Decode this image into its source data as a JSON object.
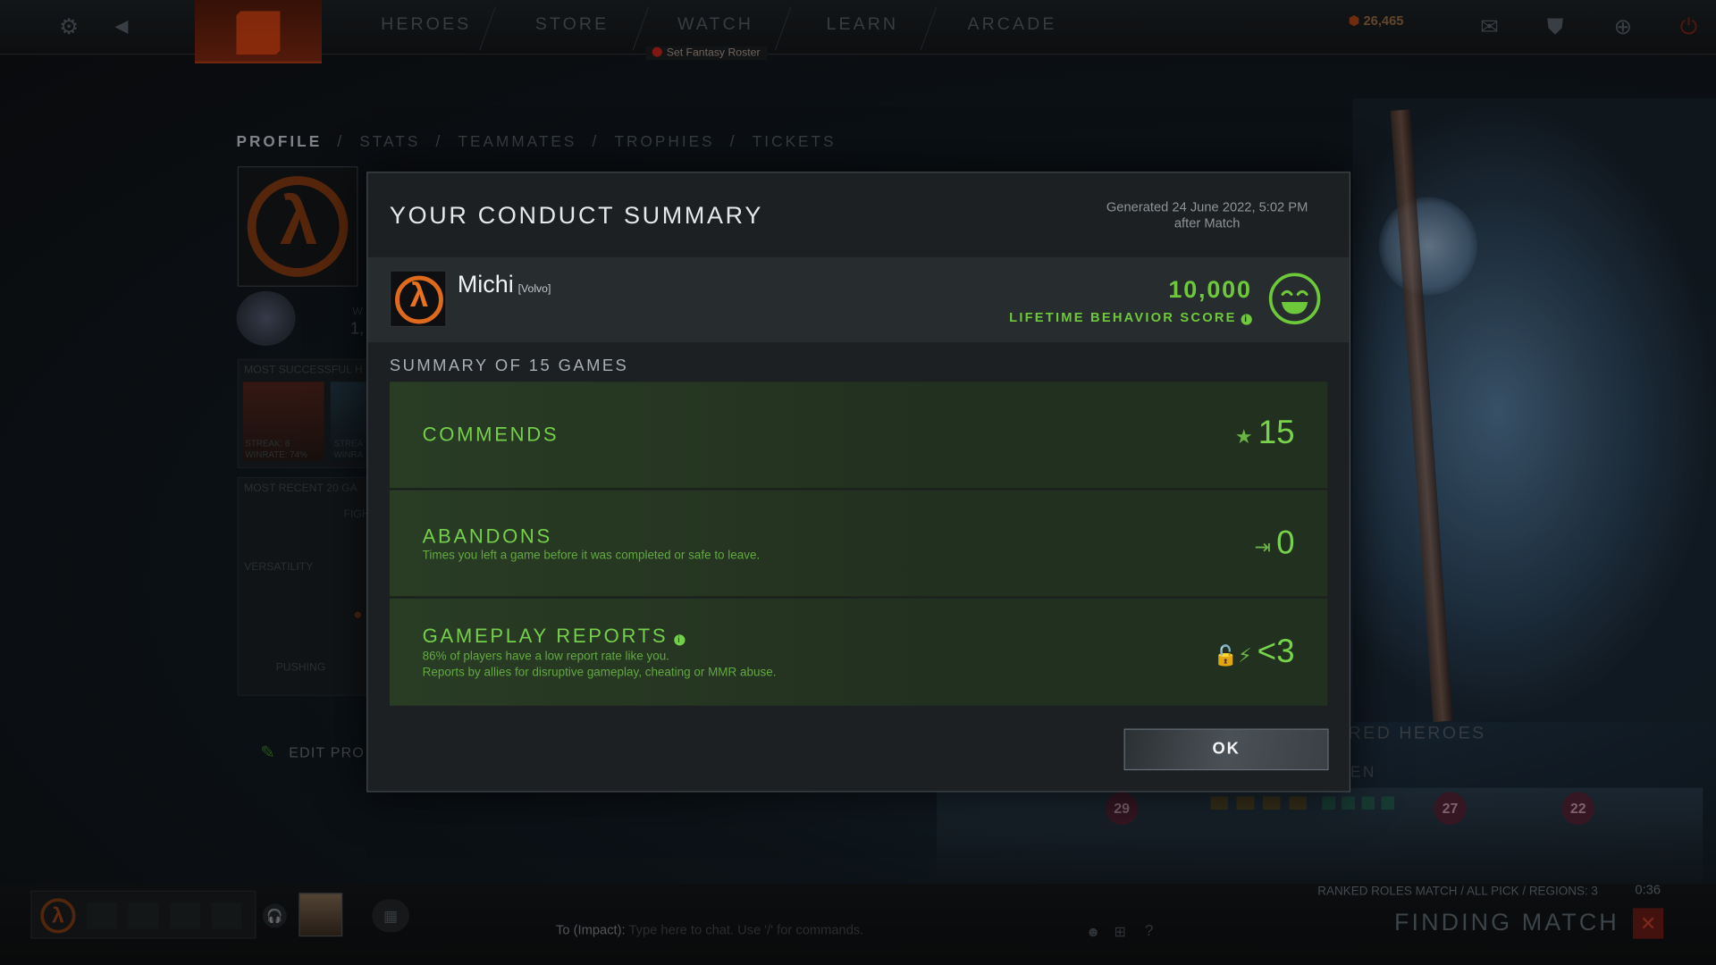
{
  "topbar": {
    "nav": [
      "HEROES",
      "STORE",
      "WATCH",
      "LEARN",
      "ARCADE"
    ],
    "fantasy_label": "Set Fantasy Roster",
    "shards": "26,465"
  },
  "background": {
    "breadcrumb": [
      "PROFILE",
      "STATS",
      "TEAMMATES",
      "TROPHIES",
      "TICKETS"
    ],
    "most_successful": "MOST SUCCESSFUL H",
    "most_recent": "MOST RECENT 20 GA",
    "versatility": "VERSATILITY",
    "pushing": "PUSHING",
    "fighting": "FIGH",
    "hero1_streak": "STREAK: 8",
    "hero1_winrate": "WINRATE: 74%",
    "hero2_streak": "STREA",
    "hero2_winrate": "WINRA",
    "wins_label": "W",
    "wins_value": "1,",
    "edit_profile": "EDIT PRO",
    "featured": "RED HEROES",
    "featured_sub": "EN",
    "hero_levels": [
      "29",
      "27",
      "22"
    ]
  },
  "bottombar": {
    "chat_prefix": "To (Impact):",
    "chat_placeholder": "Type here to chat. Use '/' for commands.",
    "match_info": "RANKED ROLES MATCH  /  ALL PICK  /  REGIONS: 3",
    "match_time": "0:36",
    "finding": "FINDING MATCH"
  },
  "dialog": {
    "title": "YOUR CONDUCT SUMMARY",
    "generated_line1": "Generated 24 June 2022, 5:02 PM",
    "generated_line2": "after Match",
    "player": {
      "name": "Michi",
      "tag": "[Volvo]"
    },
    "behavior_score": "10,000",
    "behavior_label": "LIFETIME BEHAVIOR SCORE",
    "summary_label": "SUMMARY OF 15 GAMES",
    "stats": {
      "commends": {
        "title": "COMMENDS",
        "value": "15"
      },
      "abandons": {
        "title": "ABANDONS",
        "desc": "Times you left a game before it was completed or safe to leave.",
        "value": "0"
      },
      "reports": {
        "title": "GAMEPLAY REPORTS",
        "desc1": "86% of players have a low report rate like you.",
        "desc2": "Reports by allies for disruptive gameplay, cheating or MMR abuse.",
        "value": "<3"
      }
    },
    "ok_label": "OK"
  },
  "colors": {
    "accent_green": "#74d04a",
    "score_green": "#6ec93a",
    "avatar_orange": "#e8721e",
    "dialog_bg": "#1c2022"
  }
}
